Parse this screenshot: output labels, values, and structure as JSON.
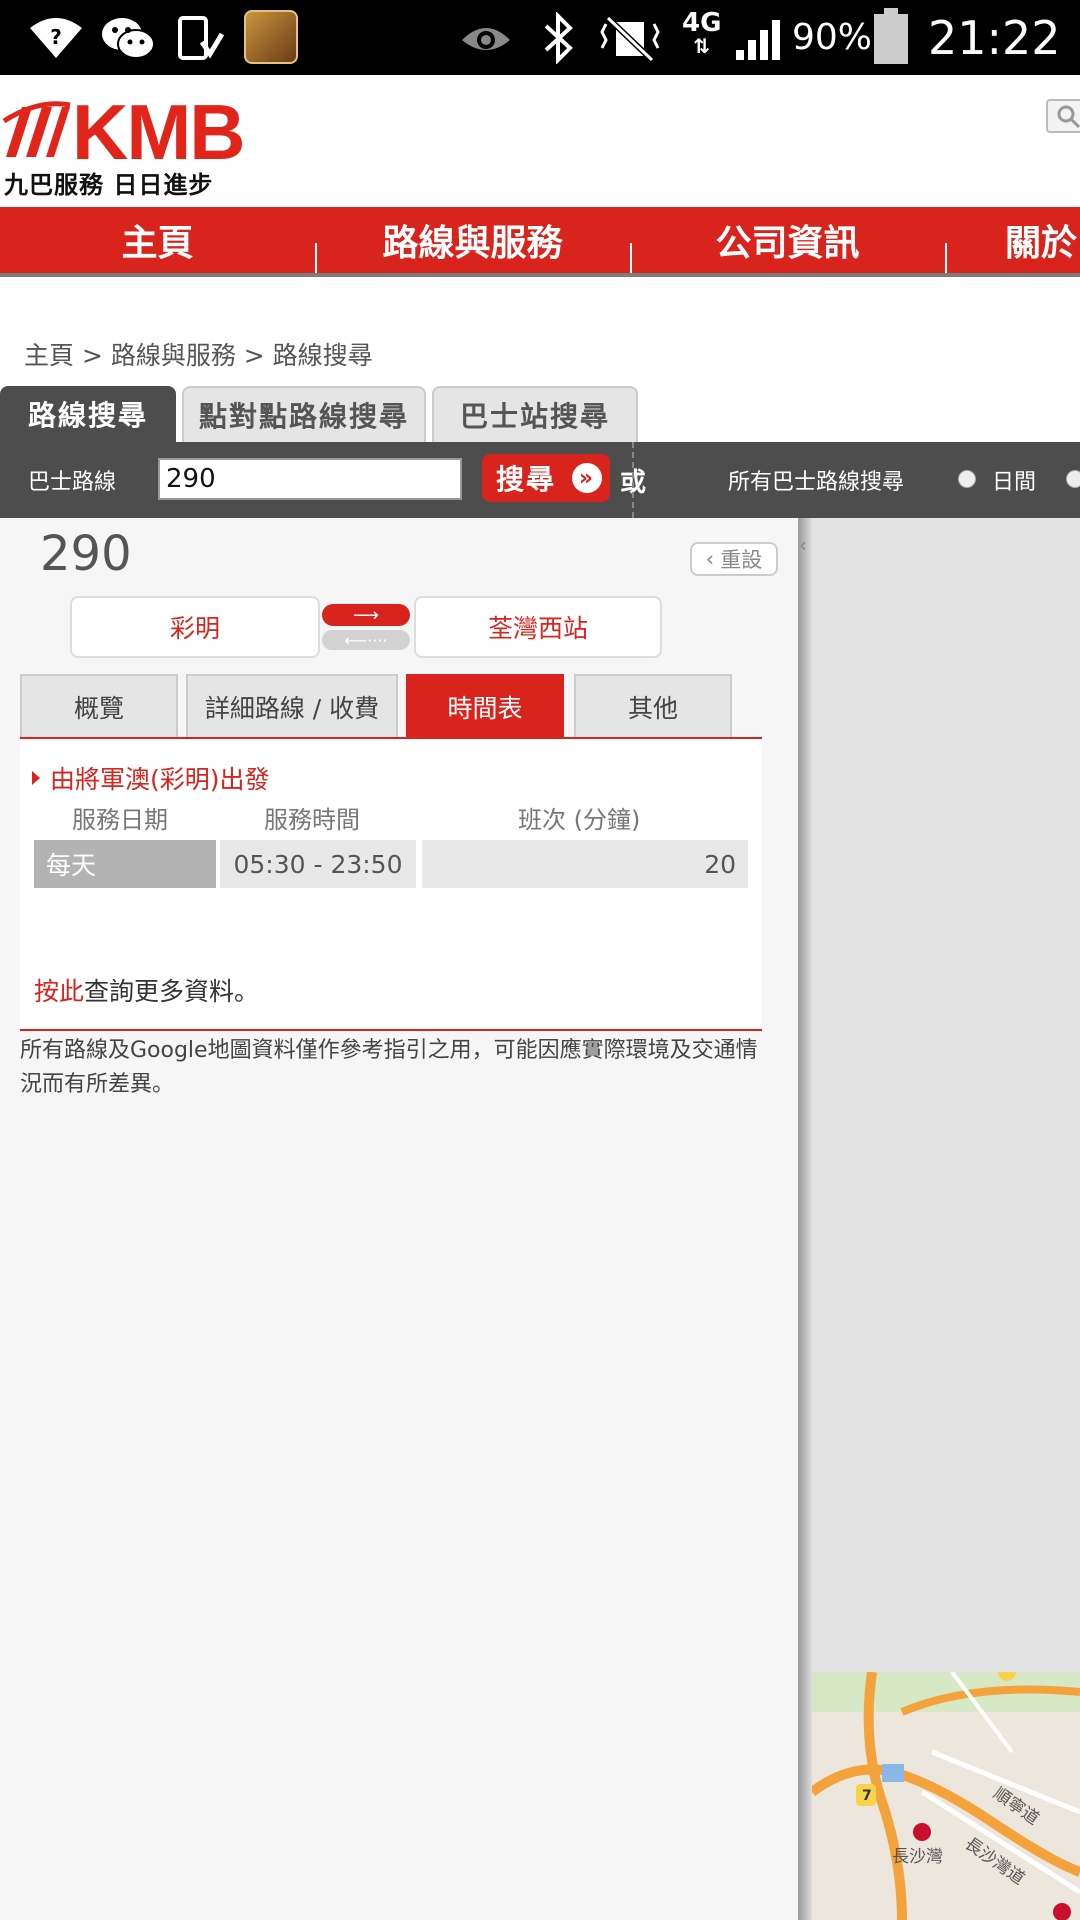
{
  "status_bar": {
    "battery_pct": "90%",
    "time": "21:22",
    "network": "4G"
  },
  "header": {
    "logo_text": "KMB",
    "logo_slogan": "九巴服務 日日進步"
  },
  "nav": {
    "items": [
      "主頁",
      "路線與服務",
      "公司資訊",
      "關於"
    ]
  },
  "breadcrumb": "主頁 > 路線與服務 > 路線搜尋",
  "search_tabs": [
    "路線搜尋",
    "點對點路線搜尋",
    "巴士站搜尋"
  ],
  "search_bar": {
    "route_label": "巴士路線",
    "route_value": "290",
    "search_button": "搜尋",
    "or_label": "或",
    "all_routes_label": "所有巴士路線搜尋",
    "day_option": "日間"
  },
  "route": {
    "number": "290",
    "reset_label": "重設",
    "origin": "彩明",
    "destination": "荃灣西站"
  },
  "info_tabs": [
    "概覽",
    "詳細路線 / 收費",
    "時間表",
    "其他"
  ],
  "timetable": {
    "departure_label": "由將軍澳(彩明)出發",
    "headers": [
      "服務日期",
      "服務時間",
      "班次 (分鐘)"
    ],
    "rows": [
      {
        "day": "每天",
        "time": "05:30 - 23:50",
        "frequency": "20"
      }
    ]
  },
  "more_info": {
    "link_text": "按此",
    "rest_text": "查詢更多資料。"
  },
  "disclaimer": "所有路線及Google地圖資料僅作參考指引之用，可能因應實際環境及交通情況而有所差異。",
  "map": {
    "labels": [
      "長沙灣",
      "順寧道",
      "長沙灣道",
      "7"
    ]
  },
  "colors": {
    "brand_red": "#d9231d",
    "bar_gray": "#4d4d4d"
  }
}
